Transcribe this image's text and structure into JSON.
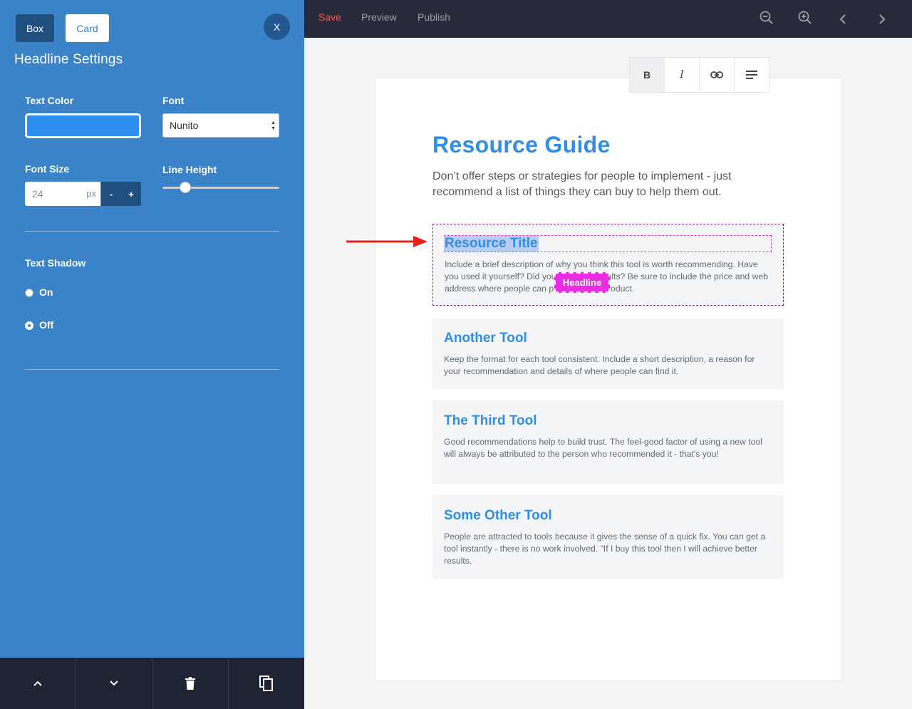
{
  "panel": {
    "tabs": {
      "box": "Box",
      "card": "Card"
    },
    "close_label": "X",
    "title": "Headline Settings",
    "text_color": {
      "label": "Text Color",
      "value": "#2e8ef0"
    },
    "font": {
      "label": "Font",
      "value": "Nunito"
    },
    "font_size": {
      "label": "Font Size",
      "value": "24",
      "unit": "px",
      "minus": "-",
      "plus": "+"
    },
    "line_height": {
      "label": "Line Height",
      "value_fraction": 0.2
    },
    "text_shadow": {
      "label": "Text Shadow",
      "on_label": "On",
      "off_label": "Off",
      "selected": "Off"
    },
    "footer_icons": [
      "chevron-up-icon",
      "chevron-down-icon",
      "trash-icon",
      "copy-icon"
    ]
  },
  "topbar": {
    "save": "Save",
    "preview": "Preview",
    "publish": "Publish",
    "icons": [
      "zoom-out-icon",
      "zoom-in-icon",
      "chevron-left-icon",
      "chevron-right-icon"
    ]
  },
  "format_toolbar": {
    "bold": "B",
    "italic": "I"
  },
  "document": {
    "title": "Resource Guide",
    "intro": "Don’t offer steps or strategies for people to implement - just recommend a list of things they can buy to help them out.",
    "cards": [
      {
        "title": "Resource Title",
        "body": "Include a brief description of why you think this tool is worth recommending. Have you used it yourself? Did you get good results? Be sure to include the price and web address where people can purchase this product.",
        "badge": "Headline"
      },
      {
        "title": "Another Tool",
        "body": "Keep the format for each tool consistent. Include a short description, a reason for your recommendation and details of where people can find it."
      },
      {
        "title": "The Third Tool",
        "body": "Good recommendations help to build trust. The feel-good factor of using a new tool will always be attributed to the person who recommended it - that's you!"
      },
      {
        "title": "Some Other Tool",
        "body": "People are attracted to tools because it gives the sense of a quick fix. You can get a tool instantly - there is no work involved. \"If I buy this tool then I will achieve better results."
      }
    ]
  },
  "colors": {
    "panel_bg": "#3b83c8",
    "accent_blue": "#2e8ee8",
    "save_red": "#e85a55",
    "selection_magenta": "#ea2de3"
  }
}
